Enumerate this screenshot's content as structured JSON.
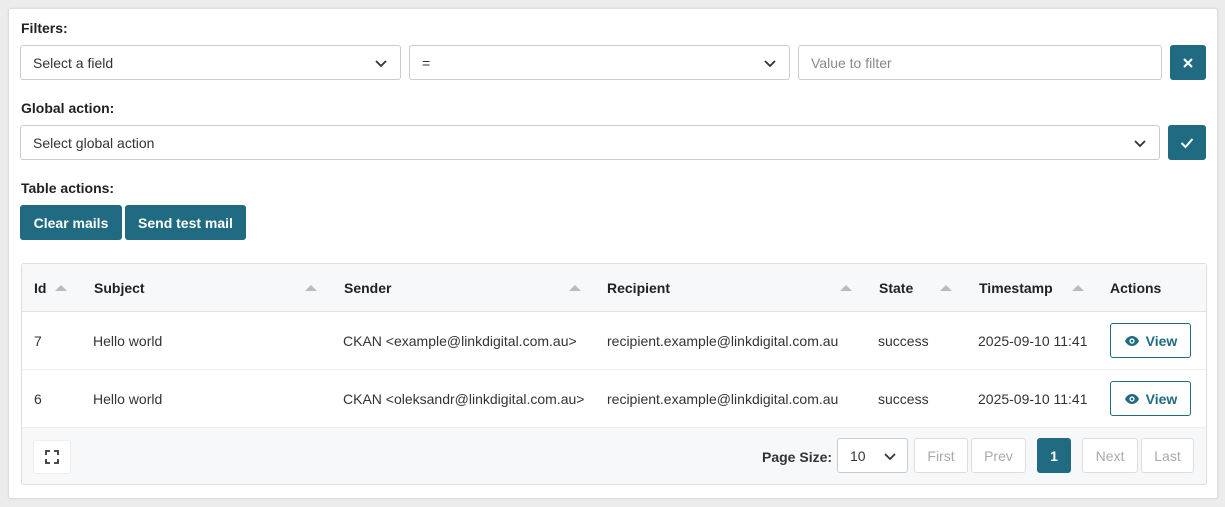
{
  "filters": {
    "label": "Filters:",
    "field_select": "Select a field",
    "operator_select": "=",
    "value_placeholder": "Value to filter",
    "clear_icon": "close-icon"
  },
  "global_action": {
    "label": "Global action:",
    "select": "Select global action",
    "apply_icon": "check-icon"
  },
  "table_actions": {
    "label": "Table actions:",
    "clear_mails": "Clear mails",
    "send_test_mail": "Send test mail"
  },
  "table": {
    "columns": [
      "Id",
      "Subject",
      "Sender",
      "Recipient",
      "State",
      "Timestamp",
      "Actions"
    ],
    "rows": [
      {
        "id": "7",
        "subject": "Hello world",
        "sender": "CKAN <example@linkdigital.com.au>",
        "recipient": "recipient.example@linkdigital.com.au",
        "state": "success",
        "timestamp": "2025-09-10 11:41",
        "action": "View"
      },
      {
        "id": "6",
        "subject": "Hello world",
        "sender": "CKAN <oleksandr@linkdigital.com.au>",
        "recipient": "recipient.example@linkdigital.com.au",
        "state": "success",
        "timestamp": "2025-09-10 11:41",
        "action": "View"
      }
    ]
  },
  "pagination": {
    "page_size_label": "Page Size:",
    "page_size": "10",
    "first": "First",
    "prev": "Prev",
    "current": "1",
    "next": "Next",
    "last": "Last"
  },
  "colors": {
    "primary": "#206b82"
  }
}
